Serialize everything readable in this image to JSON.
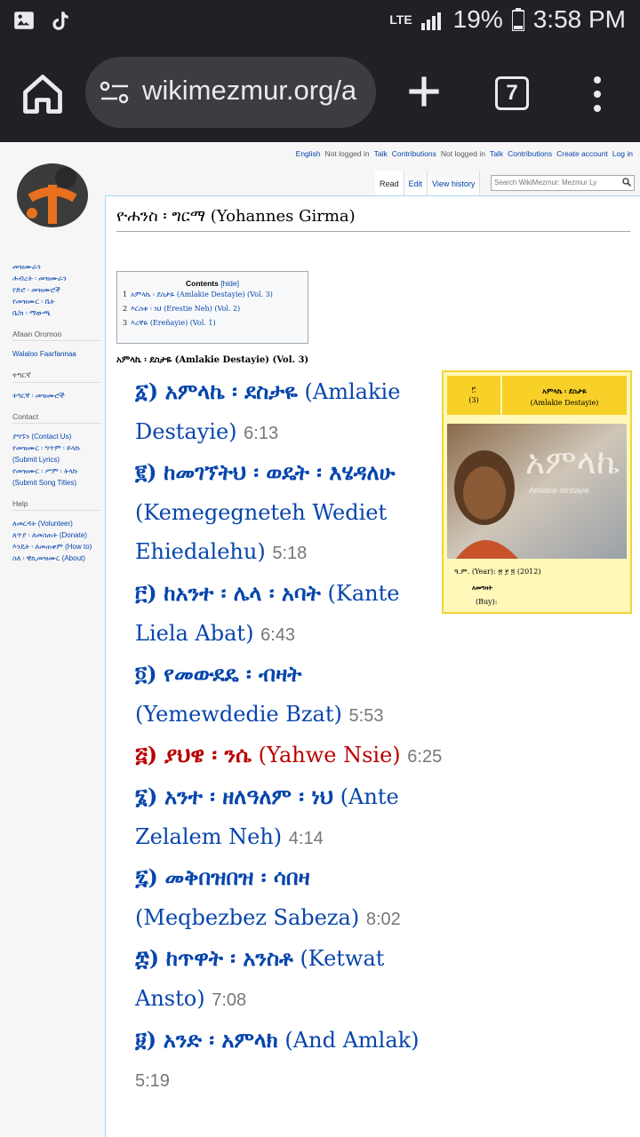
{
  "status_bar": {
    "network": "LTE",
    "battery": "19%",
    "time": "3:58 PM"
  },
  "browser": {
    "url": "wikimezmur.org/a",
    "tab_count": "7"
  },
  "wiki": {
    "personal": {
      "language": "English",
      "not_logged_in_1": "Not logged in",
      "talk_1": "Talk",
      "contributions_1": "Contributions",
      "not_logged_in_2": "Not logged in",
      "talk_2": "Talk",
      "contributions_2": "Contributions",
      "create_account": "Create account",
      "log_in": "Log in"
    },
    "tabs": {
      "read": "Read",
      "edit": "Edit",
      "view_history": "View history"
    },
    "search_placeholder": "Search WikiMezmur: Mezmur Ly",
    "sidebar": {
      "nav": [
        "መዝሙራን",
        "ሕብረት ፡ መዝሙራን",
        "የድሮ ፡ መዝሙሮች",
        "የመዝሙር ፡ ቤት",
        "ቤ/ክ ፡ ማውጫ"
      ],
      "oromo_heading": "Afaan Oromoo",
      "oromo_link": "Walaloo Faarfannaa",
      "tigrinya_heading": "ትግርኛ",
      "tigrinya_link": "ትግርኛ ፡ መዝሙሮች",
      "contact_heading": "Contact",
      "contact_links": [
        "ያግኙን (Contact Us)",
        "የመዝሙር ፡ ግጥም ፡ ይላኩ (Submit Lyrics)",
        "የመዝሙር ፡ ሥም ፡ ትላኩ (Submit Song Titles)"
      ],
      "help_heading": "Help",
      "help_links": [
        "ለመርዳት (Volunteer)",
        "ለጥያ ፡ ለመስጠት (Donate)",
        "እንዴት ፡ ለመጠቀም (How to)",
        "ስለ ፡ ዊኪመዝሙር (About)"
      ]
    },
    "page_title": "ዮሐንስ ፡ ግርማ (Yohannes Girma)",
    "toc": {
      "title": "Contents",
      "hide": "[hide]",
      "items": [
        {
          "num": "1",
          "text": "አምላኬ ፡ ደስታዬ (Amlakie Destayie) (Vol. 3)"
        },
        {
          "num": "2",
          "text": "እርስቱ ፡ ነህ (Erestie Neh) (Vol. 2)"
        },
        {
          "num": "3",
          "text": "እረኛዬ (Ereñayie) (Vol. 1)"
        }
      ]
    },
    "section_heading": "አምላኬ ፡ ደስታዬ (Amlakie Destayie) (Vol. 3)",
    "songs": [
      {
        "num": "፩)",
        "amh": "አምላኬ ፡ ደስታዬ",
        "eng": "(Amlakie Destayie)",
        "dur": "6:13"
      },
      {
        "num": "፪)",
        "amh": "ከመገኘትህ ፡ ወዴት ፡ እሄዳለሁ",
        "eng": "(Kemegegneteh Wediet Ehiedalehu)",
        "dur": "5:18"
      },
      {
        "num": "፫)",
        "amh": "ከአንተ ፡ ሌላ ፡ አባት",
        "eng": "(Kante Liela Abat)",
        "dur": "6:43"
      },
      {
        "num": "፬)",
        "amh": "የመውደዴ ፡ ብዛት",
        "eng": "(Yemewdedie Bzat)",
        "dur": "5:53"
      },
      {
        "num": "፭)",
        "amh": "ያህዌ ፡ ንሴ",
        "eng": "(Yahwe Nsie)",
        "dur": "6:25"
      },
      {
        "num": "፮)",
        "amh": "አንተ ፡ ዘለዓለም ፡ ነህ",
        "eng": "(Ante Zelalem Neh)",
        "dur": "4:14"
      },
      {
        "num": "፯)",
        "amh": "መቅበዝበዝ ፡ ሳበዛ",
        "eng": "(Meqbezbez Sabeza)",
        "dur": "8:02"
      },
      {
        "num": "፰)",
        "amh": "ከጥዋት ፡ አንስቶ",
        "eng": "(Ketwat Ansto)",
        "dur": "7:08"
      },
      {
        "num": "፱)",
        "amh": "አንድ ፡ አምላክ",
        "eng": "(And Amlak)",
        "dur": "5:19"
      }
    ],
    "infobox": {
      "vol_amh": "፫",
      "vol_num": "(3)",
      "title_amh": "አምላኬ ፡ ደስታዬ",
      "title_eng": "(Amlakie Destayie)",
      "cover_text": "አምላኬ ደስታዬ",
      "cover_sub": "Amlakie destayie",
      "year": "ዓ.ም. (Year): ፳ ፻ ፬ (2012)",
      "buy_label": "ለመግዛት",
      "buy": "(Buy):"
    }
  },
  "colors": {
    "link": "#0645ad",
    "red_link": "#ba0000",
    "chrome_dark": "#202124",
    "infobox_bg": "#fff8b8",
    "infobox_head": "#f7d028"
  }
}
